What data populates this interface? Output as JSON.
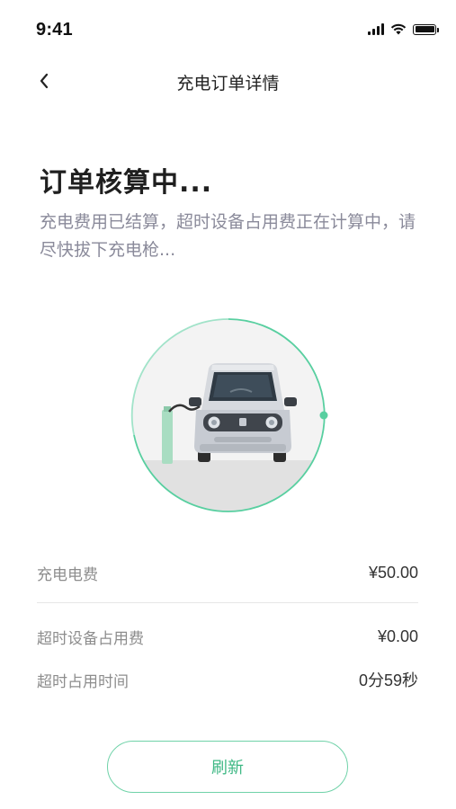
{
  "status_bar": {
    "time": "9:41",
    "icons": [
      "signal-icon",
      "wifi-icon",
      "battery-icon"
    ]
  },
  "nav": {
    "back_icon": "chevron-left-icon",
    "title": "充电订单详情"
  },
  "order": {
    "heading": "订单核算中...",
    "description": "充电费用已结算，超时设备占用费正在计算中，请尽快拔下充电枪..."
  },
  "illustration": {
    "name": "car-charging-illustration",
    "accent_color": "#58cfa0"
  },
  "fees": {
    "charging_fee": {
      "label": "充电电费",
      "value": "¥50.00"
    },
    "overtime_fee": {
      "label": "超时设备占用费",
      "value": "¥0.00"
    },
    "overtime_duration": {
      "label": "超时占用时间",
      "value": "0分59秒"
    }
  },
  "actions": {
    "refresh_label": "刷新"
  },
  "colors": {
    "accent": "#3fb885",
    "border_accent": "#6fd2a8",
    "muted_text": "#8a8a9a"
  }
}
